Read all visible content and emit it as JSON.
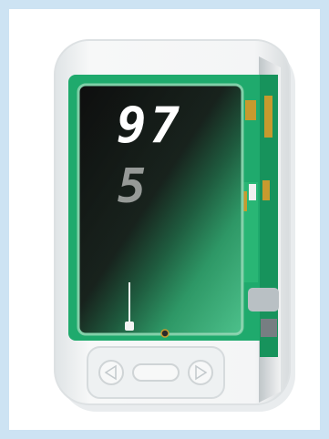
{
  "display": {
    "reading_top": "97",
    "reading_bottom": "5"
  },
  "colors": {
    "frame_border": "#cde3f3",
    "board_green": "#1faa6d",
    "screen_black": "#111111",
    "digit_white": "#ffffff",
    "casing_white": "#f2f4f5"
  },
  "icons": {
    "left_button": "triangle-left-icon",
    "middle_button": "oval-pill-icon",
    "right_button": "triangle-right-icon"
  }
}
